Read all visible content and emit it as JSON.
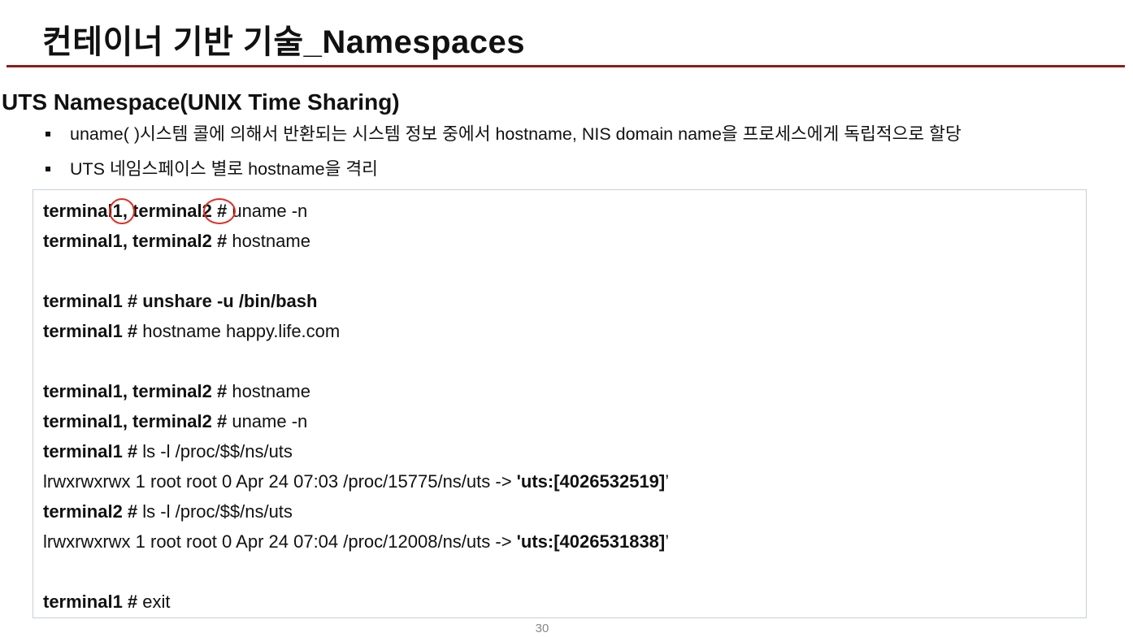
{
  "slide": {
    "title": "컨테이너 기반 기술_Namespaces",
    "subtitle": "UTS Namespace(UNIX Time Sharing)",
    "bullets": [
      "uname( )시스템 콜에 의해서 반환되는 시스템 정보 중에서 hostname, NIS domain name을 프로세스에게 독립적으로 할당",
      "UTS 네임스페이스 별로 hostname을 격리"
    ],
    "page_number": "30"
  },
  "code": {
    "line1": {
      "prompt": "terminal1, terminal2 #",
      "cmd": " uname -n"
    },
    "line2": {
      "prompt": "terminal1, terminal2 #",
      "cmd": " hostname"
    },
    "line3": {
      "prompt": "terminal1 #",
      "cmd": " unshare -u /bin/bash"
    },
    "line4": {
      "prompt": "terminal1 #",
      "cmd": " hostname happy.life.com"
    },
    "line5": {
      "prompt": "terminal1, terminal2 #",
      "cmd": " hostname"
    },
    "line6": {
      "prompt": "terminal1, terminal2 #",
      "cmd": " uname -n"
    },
    "line7": {
      "prompt": "terminal1 #",
      "cmd": " ls -l /proc/$$/ns/uts"
    },
    "line8": {
      "text": "lrwxrwxrwx 1 root root 0 Apr 24 07:03 /proc/15775/ns/uts -> ",
      "q1": "'",
      "uts": "uts:[4026532519]",
      "q2": "’"
    },
    "line9": {
      "prompt": "terminal2 #",
      "cmd": " ls -l /proc/$$/ns/uts"
    },
    "line10": {
      "text": "lrwxrwxrwx 1 root root 0 Apr 24 07:04 /proc/12008/ns/uts -> ",
      "q1": "'",
      "uts": "uts:[4026531838]",
      "q2": "’"
    },
    "line11": {
      "prompt": "terminal1 #",
      "cmd": " exit"
    }
  },
  "annotation_color": "#e03024",
  "accent_rule_color": "#8b1e1a"
}
